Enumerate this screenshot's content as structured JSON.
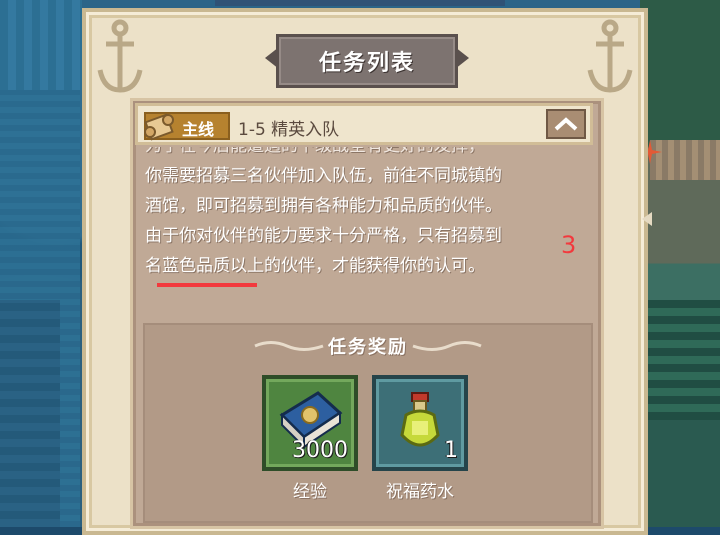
{
  "panel": {
    "title": "任务列表"
  },
  "quest": {
    "tag": "主线",
    "title": "1-5 精英入队",
    "description_lines": [
      "为了在今后能遭遇的下级战全有更好的发挥，",
      "你需要招募三名伙伴加入队伍，前往不同城镇的",
      "酒馆，即可招募到拥有各种能力和品质的伙伴。",
      "由于你对伙伴的能力要求十分严格，只有招募到",
      "名蓝色品质以上的伙伴，才能获得你的认可。"
    ],
    "annotation_number": "3"
  },
  "rewards": {
    "title": "任务奖励",
    "items": [
      {
        "label": "经验",
        "quantity": "3000",
        "icon": "book-icon"
      },
      {
        "label": "祝福药水",
        "quantity": "1",
        "icon": "potion-icon"
      }
    ]
  },
  "colors": {
    "panel_bg": "#ece1c8",
    "card_bg": "#c0a996",
    "tag_bg": "#b6822f",
    "annotation_red": "#f2393d",
    "slot_green": "#4f8540",
    "slot_teal": "#3d6f77"
  }
}
